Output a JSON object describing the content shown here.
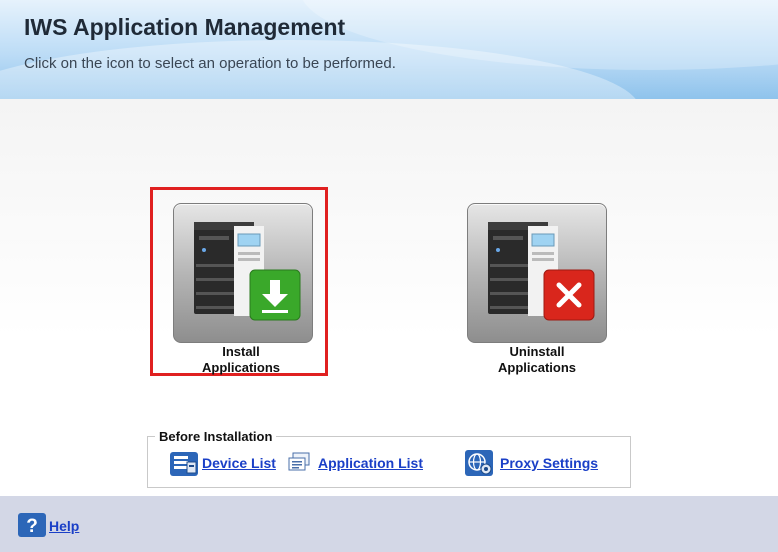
{
  "header": {
    "title": "IWS Application Management",
    "subtitle": "Click on the icon to select an operation to be performed."
  },
  "operations": {
    "install": {
      "label_line1": "Install",
      "label_line2": "Applications",
      "selected": true
    },
    "uninstall": {
      "label_line1": "Uninstall",
      "label_line2": "Applications"
    }
  },
  "before_installation": {
    "legend": "Before Installation",
    "device_list": "Device List",
    "application_list": "Application List",
    "proxy_settings": "Proxy Settings"
  },
  "footer": {
    "help": "Help"
  },
  "colors": {
    "highlight": "#e02020",
    "install_badge": "#3aa82a",
    "uninstall_badge": "#d9261c",
    "link": "#1a3fc7"
  },
  "icons": {
    "install": "printer-download-icon",
    "uninstall": "printer-remove-icon",
    "device_list": "device-list-icon",
    "application_list": "application-list-icon",
    "proxy_settings": "globe-gear-icon",
    "help": "question-icon"
  }
}
